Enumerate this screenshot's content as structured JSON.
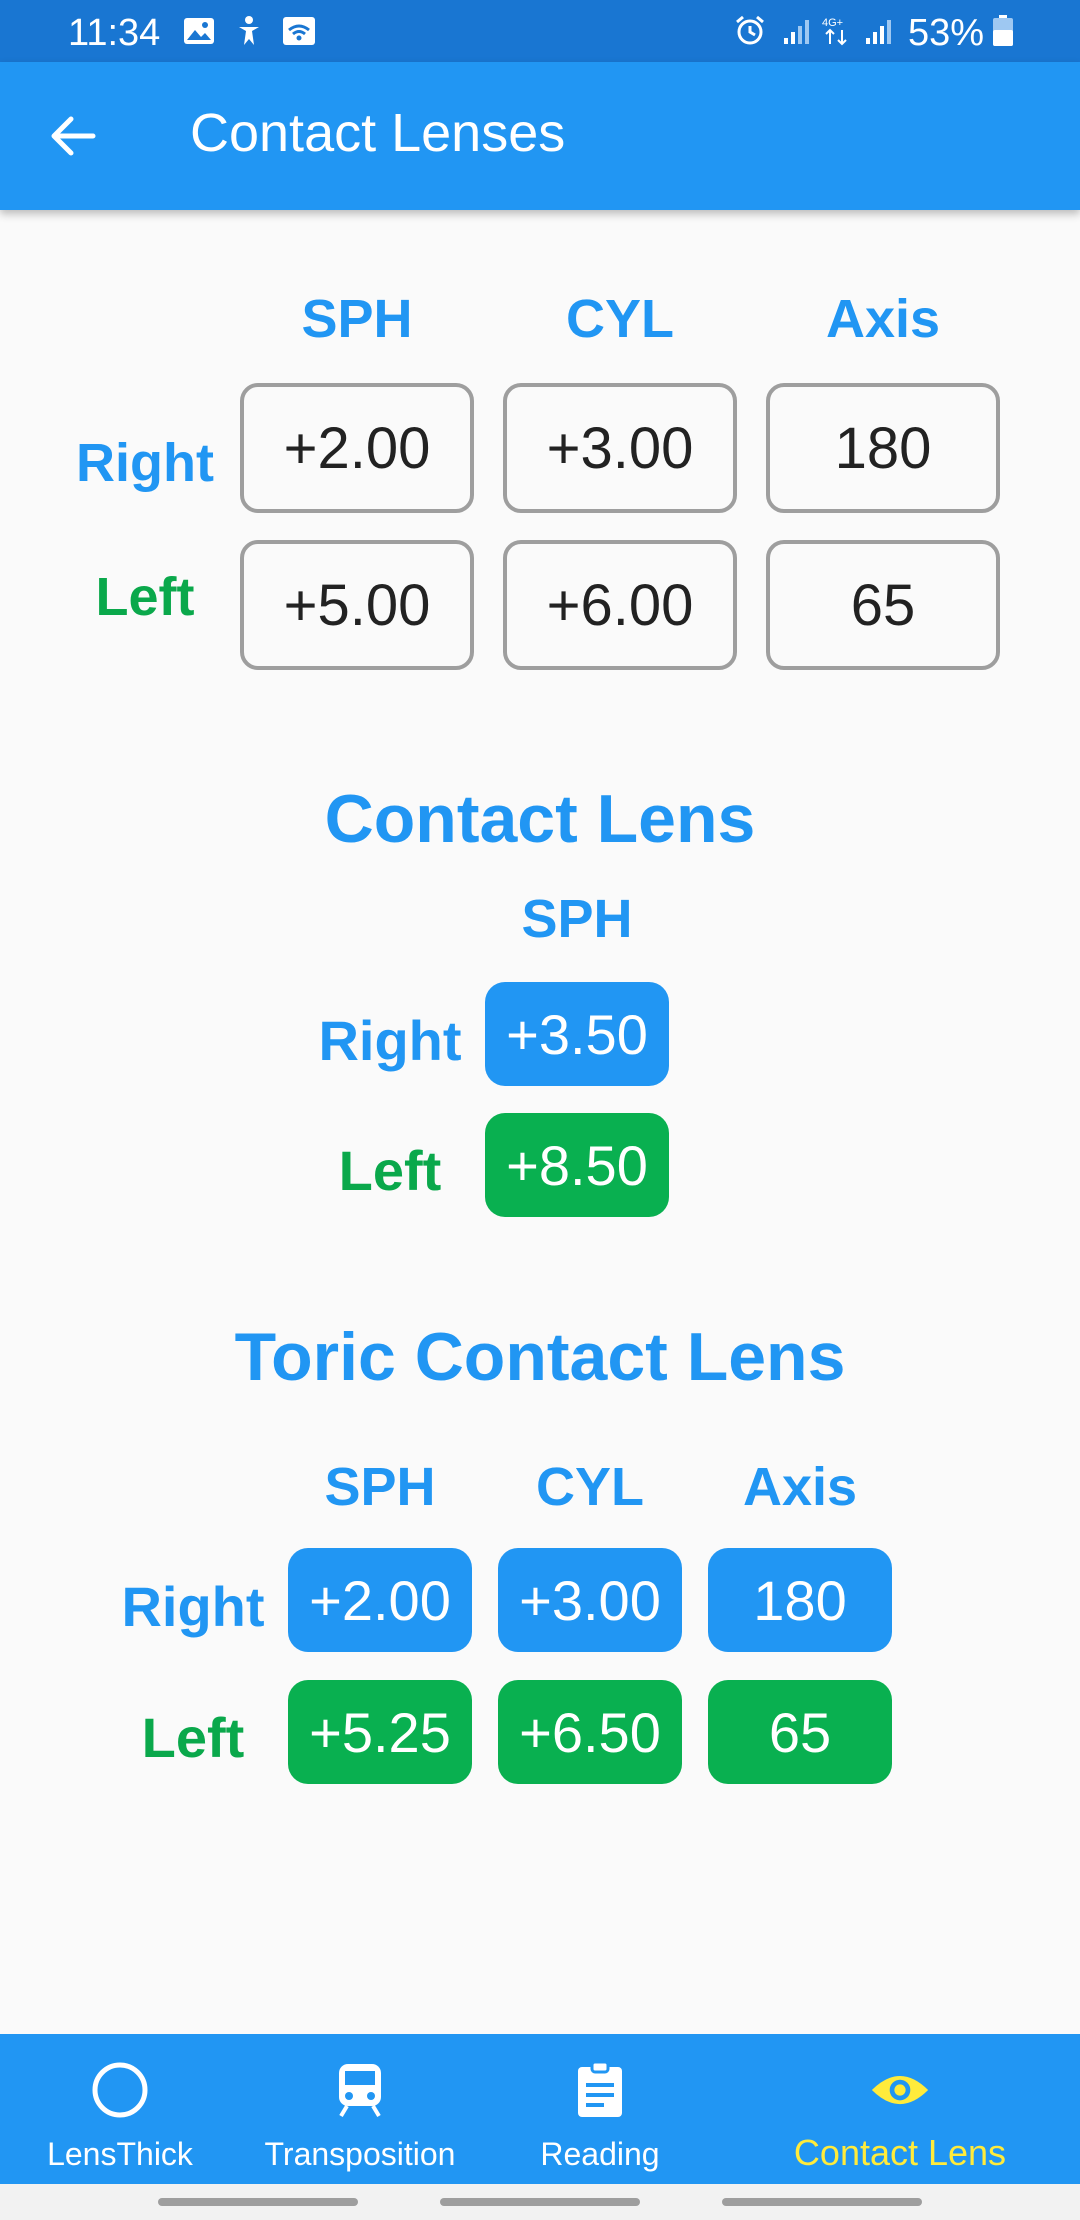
{
  "status_bar": {
    "time": "11:34",
    "battery": "53%"
  },
  "app_bar": {
    "title": "Contact Lenses"
  },
  "input": {
    "headers": [
      "SPH",
      "CYL",
      "Axis"
    ],
    "right_label": "Right",
    "left_label": "Left",
    "right": [
      "+2.00",
      "+3.00",
      "180"
    ],
    "left": [
      "+5.00",
      "+6.00",
      "65"
    ]
  },
  "contact_lens": {
    "title": "Contact Lens",
    "header": "SPH",
    "right_label": "Right",
    "left_label": "Left",
    "right": "+3.50",
    "left": "+8.50"
  },
  "toric": {
    "title": "Toric Contact Lens",
    "headers": [
      "SPH",
      "CYL",
      "Axis"
    ],
    "right_label": "Right",
    "left_label": "Left",
    "right": [
      "+2.00",
      "+3.00",
      "180"
    ],
    "left": [
      "+5.25",
      "+6.50",
      "65"
    ]
  },
  "bottom_nav": {
    "items": [
      {
        "label": "LensThick",
        "icon": "circle-icon"
      },
      {
        "label": "Transposition",
        "icon": "train-icon"
      },
      {
        "label": "Reading",
        "icon": "clipboard-icon"
      },
      {
        "label": "Contact Lens",
        "icon": "eye-icon",
        "active": true
      }
    ]
  },
  "colors": {
    "primary": "#2196f3",
    "status_bar": "#1976d2",
    "green": "#0aa84b",
    "active_nav": "#ffeb3b"
  }
}
